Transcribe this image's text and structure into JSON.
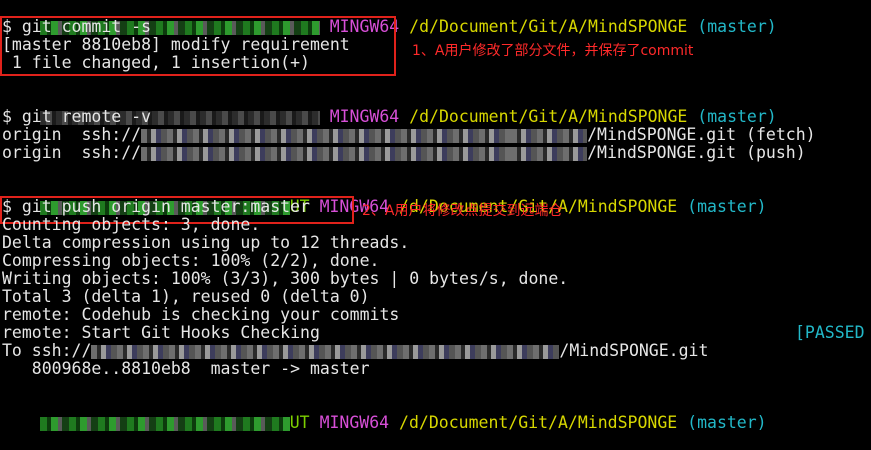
{
  "prompt": {
    "shell": "MINGW64",
    "path": "/d/Document/Git/A/MindSPONGE",
    "branch": "(master)",
    "user_fragment": "UT"
  },
  "block1": {
    "command": "$ git commit -s",
    "out1": "[master 8810eb8] modify requirement",
    "out2": " 1 file changed, 1 insertion(+)",
    "annotation": "1、A用户修改了部分文件，并保存了commit"
  },
  "block2": {
    "command": "git remote -v",
    "remote_name": "origin",
    "proto": "ssh://",
    "repo": "/MindSPONGE.git",
    "fetch": "(fetch)",
    "push": "(push)"
  },
  "block3": {
    "command": "$ git push origin master:master",
    "annotation": "2、A用户将修改点提交到远端仓",
    "lines": [
      "Counting objects: 3, done.",
      "Delta compression using up to 12 threads.",
      "Compressing objects: 100% (2/2), done.",
      "Writing objects: 100% (3/3), 300 bytes | 0 bytes/s, done.",
      "Total 3 (delta 1), reused 0 (delta 0)",
      "remote: Codehub is checking your commits",
      "remote: Start Git Hooks Checking"
    ],
    "passed": "[PASSED",
    "to_prefix": "To ssh://",
    "to_repo": "/MindSPONGE.git",
    "update": "   800968e..8810eb8  master -> master"
  }
}
